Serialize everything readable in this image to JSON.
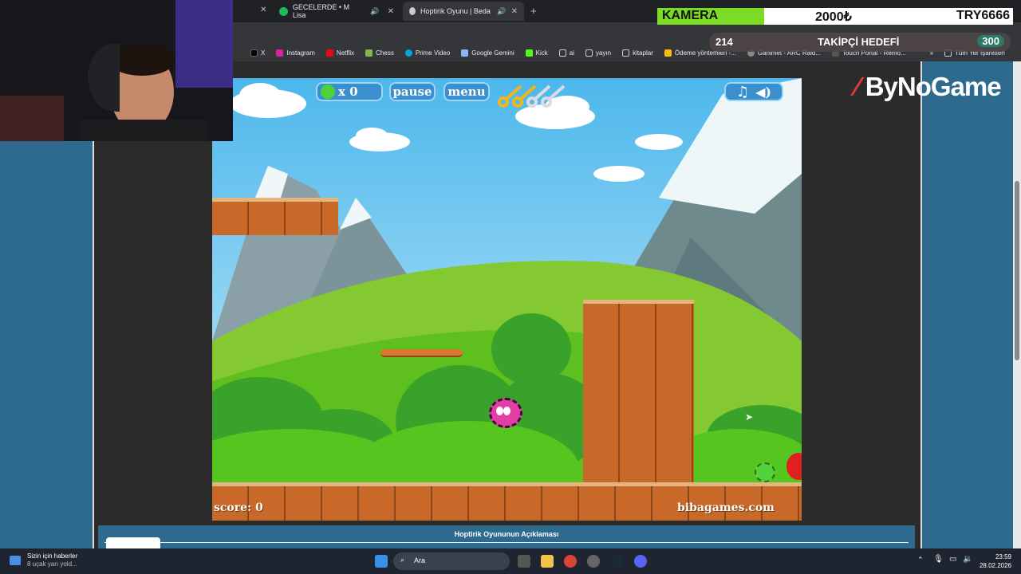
{
  "browser": {
    "tabs": [
      {
        "label": "GECELERDE • M Lisa",
        "active": false
      },
      {
        "label": "Hoptirik Oyunu | Bedava Be",
        "active": true
      }
    ],
    "bookmarks": [
      "X",
      "Instagram",
      "Netflix",
      "Chess",
      "Prime Video",
      "Google Gemini",
      "Kick",
      "ai",
      "yayın",
      "kitaplar",
      "Ödeme yöntemleri -...",
      "Ganimet - ARC Raid...",
      "Touch Portal - Remo..."
    ],
    "all_bookmarks": "Tüm Yer İşaretleri"
  },
  "game": {
    "lives": "x 0",
    "pause_label": "pause",
    "menu_label": "menu",
    "keys_count": 4,
    "score": "score: 0",
    "site": "bibagames.com"
  },
  "page": {
    "description_title": "Hoptirik Oyununun Açıklaması"
  },
  "overlay": {
    "camera_label": "KAMERA",
    "camera_amount": "2000₺",
    "camera_target": "TRY6666",
    "camera_progress": 0.3,
    "follower_current": "214",
    "follower_label": "TAKİPÇİ HEDEFİ",
    "follower_target": "300",
    "brand": "ByNoGame"
  },
  "taskbar": {
    "news_title": "Sizin için haberler",
    "news_sub": "8 uçak yarı yold...",
    "search_label": "Ara",
    "time": "23:59",
    "date": "28.02.2026"
  }
}
